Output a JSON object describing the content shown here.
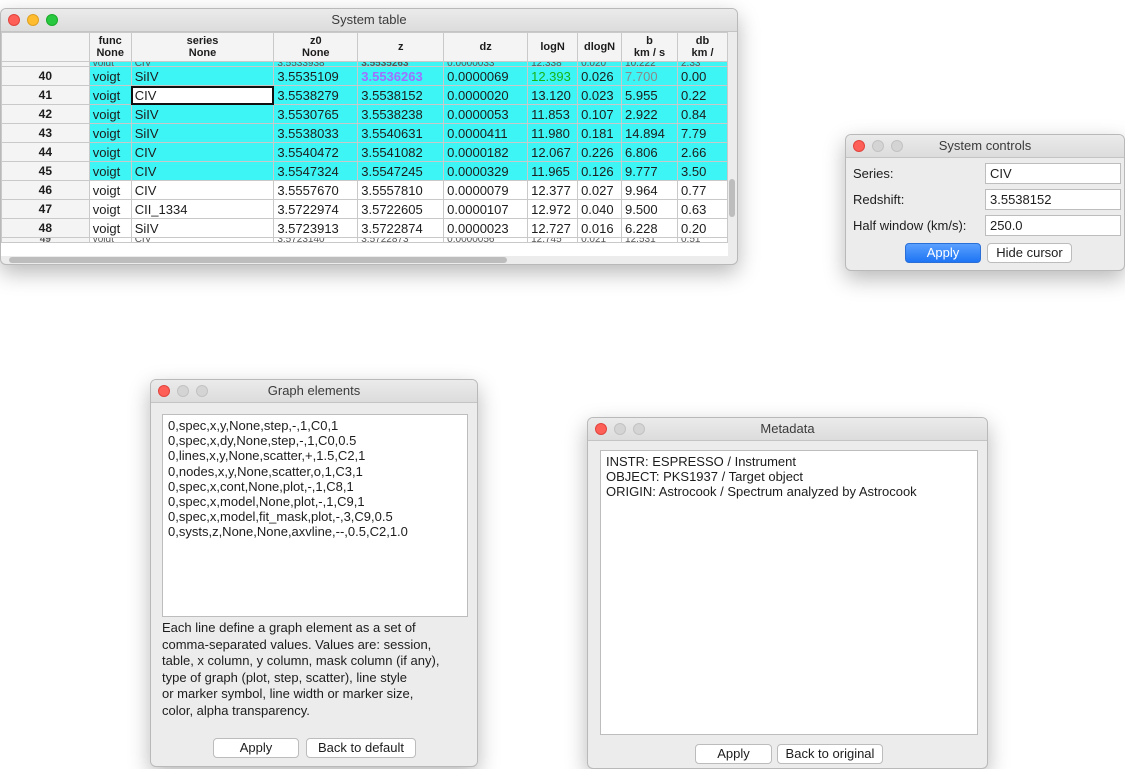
{
  "system_table": {
    "title": "System table",
    "headers": [
      {
        "top": "func",
        "bottom": "None"
      },
      {
        "top": "series",
        "bottom": "None"
      },
      {
        "top": "z0",
        "bottom": "None"
      },
      {
        "top": "z",
        "bottom": ""
      },
      {
        "top": "dz",
        "bottom": ""
      },
      {
        "top": "logN",
        "bottom": ""
      },
      {
        "top": "dlogN",
        "bottom": ""
      },
      {
        "top": "b",
        "bottom": "km / s"
      },
      {
        "top": "db",
        "bottom": "km /"
      }
    ],
    "top_partial": [
      "voigt",
      "CIV",
      "3.5533938",
      "3.5535263",
      "0.0000033",
      "12.338",
      "0.020",
      "10.222",
      "2.33"
    ],
    "rows": [
      {
        "idx": "40",
        "cells": [
          "voigt",
          "SiIV",
          "3.5535109",
          "3.5536263",
          "0.0000069",
          "12.393",
          "0.026",
          "7.700",
          "0.00"
        ]
      },
      {
        "idx": "41",
        "cells": [
          "voigt",
          "CIV",
          "3.5538279",
          "3.5538152",
          "0.0000020",
          "13.120",
          "0.023",
          "5.955",
          "0.22"
        ]
      },
      {
        "idx": "42",
        "cells": [
          "voigt",
          "SiIV",
          "3.5530765",
          "3.5538238",
          "0.0000053",
          "11.853",
          "0.107",
          "2.922",
          "0.84"
        ]
      },
      {
        "idx": "43",
        "cells": [
          "voigt",
          "SiIV",
          "3.5538033",
          "3.5540631",
          "0.0000411",
          "11.980",
          "0.181",
          "14.894",
          "7.79"
        ]
      },
      {
        "idx": "44",
        "cells": [
          "voigt",
          "CIV",
          "3.5540472",
          "3.5541082",
          "0.0000182",
          "12.067",
          "0.226",
          "6.806",
          "2.66"
        ]
      },
      {
        "idx": "45",
        "cells": [
          "voigt",
          "CIV",
          "3.5547324",
          "3.5547245",
          "0.0000329",
          "11.965",
          "0.126",
          "9.777",
          "3.50"
        ]
      },
      {
        "idx": "46",
        "cells": [
          "voigt",
          "CIV",
          "3.5557670",
          "3.5557810",
          "0.0000079",
          "12.377",
          "0.027",
          "9.964",
          "0.77"
        ]
      },
      {
        "idx": "47",
        "cells": [
          "voigt",
          "CII_1334",
          "3.5722974",
          "3.5722605",
          "0.0000107",
          "12.972",
          "0.040",
          "9.500",
          "0.63"
        ]
      },
      {
        "idx": "48",
        "cells": [
          "voigt",
          "SiIV",
          "3.5723913",
          "3.5722874",
          "0.0000023",
          "12.727",
          "0.016",
          "6.228",
          "0.20"
        ]
      }
    ],
    "bottom_partial": {
      "idx": "49",
      "cells": [
        "voigt",
        "CIV",
        "3.5723140",
        "3.5722873",
        "0.0000056",
        "12.745",
        "0.021",
        "12.531",
        "0.51"
      ]
    },
    "colors": {
      "selected_row": "#3df5f5",
      "highlight_z": "#a070ff",
      "highlight_logN": "#17b317",
      "muted_b": "#8a8a8a"
    }
  },
  "system_controls": {
    "title": "System controls",
    "series_label": "Series:",
    "series_value": "CIV",
    "redshift_label": "Redshift:",
    "redshift_value": "3.5538152",
    "halfwin_label": "Half window (km/s):",
    "halfwin_value": "250.0",
    "apply_label": "Apply",
    "hide_label": "Hide cursor"
  },
  "graph_elements": {
    "title": "Graph elements",
    "lines": "0,spec,x,y,None,step,-,1,C0,1\n0,spec,x,dy,None,step,-,1,C0,0.5\n0,lines,x,y,None,scatter,+,1.5,C2,1\n0,nodes,x,y,None,scatter,o,1,C3,1\n0,spec,x,cont,None,plot,-,1,C8,1\n0,spec,x,model,None,plot,-,1,C9,1\n0,spec,x,model,fit_mask,plot,-,3,C9,0.5\n0,systs,z,None,None,axvline,--,0.5,C2,1.0",
    "help_lines": [
      "Each line define a graph element as a set of",
      "comma-separated values. Values are: session,",
      "table, x column, y column, mask column (if any),",
      "type of graph (plot, step, scatter), line style",
      "or marker symbol, line width or marker size,",
      "color, alpha transparency."
    ],
    "apply_label": "Apply",
    "default_label": "Back to default"
  },
  "metadata": {
    "title": "Metadata",
    "lines": "INSTR: ESPRESSO / Instrument\nOBJECT: PKS1937 / Target object\nORIGIN: Astrocook / Spectrum analyzed by Astrocook",
    "apply_label": "Apply",
    "original_label": "Back to original"
  }
}
